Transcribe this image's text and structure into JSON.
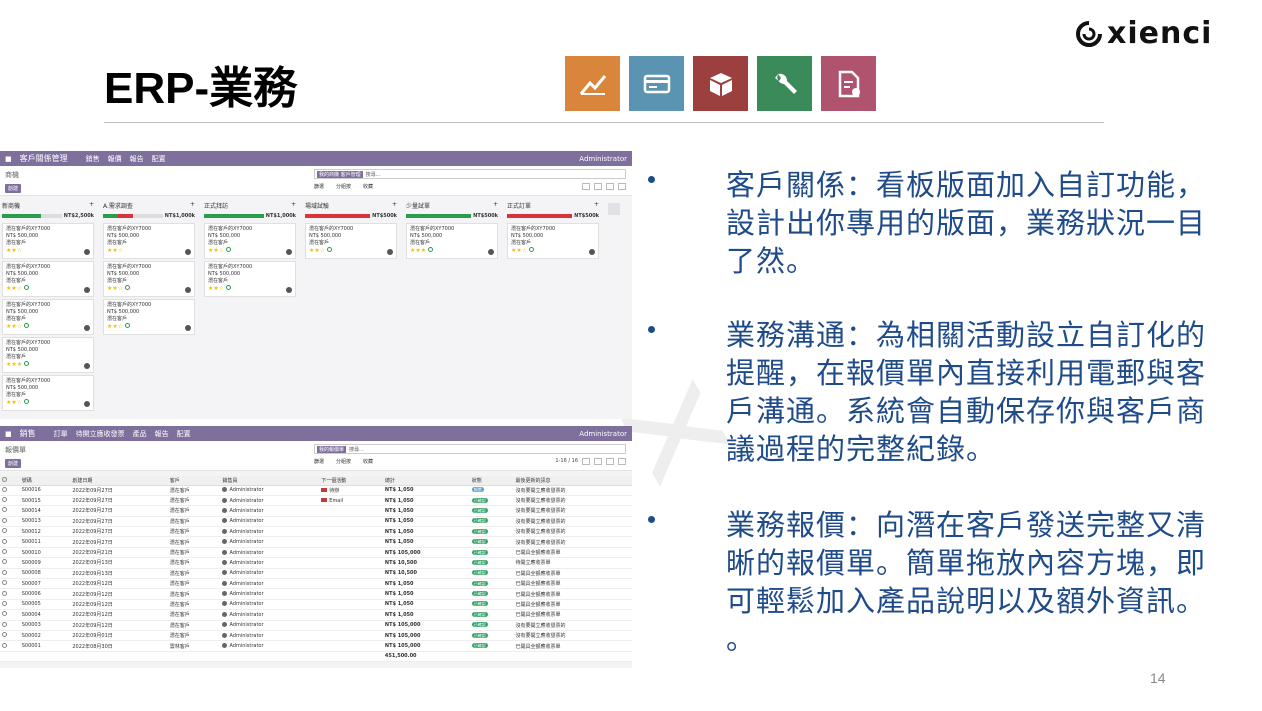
{
  "brand": {
    "logo_text": "xienci"
  },
  "slide": {
    "title": "ERP-業務",
    "page_number": "14"
  },
  "app_icons": [
    {
      "name": "chart-icon",
      "color": "#d9853b"
    },
    {
      "name": "card-icon",
      "color": "#5b94b3"
    },
    {
      "name": "box-icon",
      "color": "#9b3f3f"
    },
    {
      "name": "wrench-icon",
      "color": "#3a8a5a"
    },
    {
      "name": "doc-gear-icon",
      "color": "#b0536e"
    }
  ],
  "crm": {
    "app_name": "客戶關係管理",
    "menus": [
      "銷售",
      "報價",
      "報告",
      "配置"
    ],
    "user": "Administrator",
    "breadcrumb": "商機",
    "create_label": "創建",
    "search_facet": "我的商機 客戶管理",
    "search_placeholder": "搜尋...",
    "filters": [
      "篩選",
      "分組按",
      "收藏"
    ],
    "columns": [
      {
        "name": "新商機",
        "amount": "NT$2,500k"
      },
      {
        "name": "A.需求調查",
        "amount": "NT$1,000k"
      },
      {
        "name": "正式拜訪",
        "amount": "NT$1,000k"
      },
      {
        "name": "場域試驗",
        "amount": "NT$500k"
      },
      {
        "name": "少量試單",
        "amount": "NT$500k"
      },
      {
        "name": "正式訂單",
        "amount": "NT$500k"
      }
    ],
    "card_title": "潛在客戶的XY7000",
    "card_amount": "NT$ 500,000",
    "card_customer": "潛在客戶"
  },
  "sales": {
    "app_name": "銷售",
    "menus": [
      "訂單",
      "待開立應收發票",
      "產品",
      "報告",
      "配置"
    ],
    "user": "Administrator",
    "breadcrumb": "報價單",
    "create_label": "創建",
    "search_facet": "我的報價單",
    "search_placeholder": "搜尋...",
    "filters": [
      "篩選",
      "分組按",
      "收藏"
    ],
    "pager": "1-16 / 16",
    "headers": [
      "號碼",
      "創建日期",
      "客戶",
      "銷售員",
      "下一個活動",
      "",
      "總計",
      "狀態",
      "最後更新的訊息"
    ],
    "rows": [
      {
        "num": "S00016",
        "date": "2022年09月27日",
        "cust": "潛在客戶",
        "rep": "Administrator",
        "act": "待辦",
        "total": "NT$ 1,050",
        "status": "報價",
        "msg": "沒有要開立應收發票的"
      },
      {
        "num": "S00015",
        "date": "2022年09月27日",
        "cust": "潛在客戶",
        "rep": "Administrator",
        "act": "Email",
        "total": "NT$ 1,050",
        "status": "已確認",
        "msg": "沒有要開立應收發票的"
      },
      {
        "num": "S00014",
        "date": "2022年09月27日",
        "cust": "潛在客戶",
        "rep": "Administrator",
        "act": "",
        "total": "NT$ 1,050",
        "status": "已確認",
        "msg": "沒有要開立應收發票的"
      },
      {
        "num": "S00013",
        "date": "2022年09月27日",
        "cust": "潛在客戶",
        "rep": "Administrator",
        "act": "",
        "total": "NT$ 1,050",
        "status": "已確認",
        "msg": "沒有要開立應收發票的"
      },
      {
        "num": "S00012",
        "date": "2022年09月27日",
        "cust": "潛在客戶",
        "rep": "Administrator",
        "act": "",
        "total": "NT$ 1,050",
        "status": "已確認",
        "msg": "沒有要開立應收發票的"
      },
      {
        "num": "S00011",
        "date": "2022年09月27日",
        "cust": "潛在客戶",
        "rep": "Administrator",
        "act": "",
        "total": "NT$ 1,050",
        "status": "已確認",
        "msg": "沒有要開立應收發票的"
      },
      {
        "num": "S00010",
        "date": "2022年09月21日",
        "cust": "潛在客戶",
        "rep": "Administrator",
        "act": "",
        "total": "NT$ 105,000",
        "status": "已確認",
        "msg": "已開具全額應收票單"
      },
      {
        "num": "S00009",
        "date": "2022年09月13日",
        "cust": "潛在客戶",
        "rep": "Administrator",
        "act": "",
        "total": "NT$ 10,500",
        "status": "已確認",
        "msg": "待開立應收票單"
      },
      {
        "num": "S00008",
        "date": "2022年09月13日",
        "cust": "潛在客戶",
        "rep": "Administrator",
        "act": "",
        "total": "NT$ 10,500",
        "status": "已確認",
        "msg": "已開具全額應收票單"
      },
      {
        "num": "S00007",
        "date": "2022年09月12日",
        "cust": "潛在客戶",
        "rep": "Administrator",
        "act": "",
        "total": "NT$ 1,050",
        "status": "已確認",
        "msg": "已開具全額應收票單"
      },
      {
        "num": "S00006",
        "date": "2022年09月12日",
        "cust": "潛在客戶",
        "rep": "Administrator",
        "act": "",
        "total": "NT$ 1,050",
        "status": "已確認",
        "msg": "已開具全額應收票單"
      },
      {
        "num": "S00005",
        "date": "2022年09月12日",
        "cust": "潛在客戶",
        "rep": "Administrator",
        "act": "",
        "total": "NT$ 1,050",
        "status": "已確認",
        "msg": "已開具全額應收票單"
      },
      {
        "num": "S00004",
        "date": "2022年09月12日",
        "cust": "潛在客戶",
        "rep": "Administrator",
        "act": "",
        "total": "NT$ 1,050",
        "status": "已確認",
        "msg": "已開具全額應收票單"
      },
      {
        "num": "S00003",
        "date": "2022年09月12日",
        "cust": "潛在客戶",
        "rep": "Administrator",
        "act": "",
        "total": "NT$ 105,000",
        "status": "已確認",
        "msg": "沒有要開立應收發票的"
      },
      {
        "num": "S00002",
        "date": "2022年09月01日",
        "cust": "潛在客戶",
        "rep": "Administrator",
        "act": "",
        "total": "NT$ 105,000",
        "status": "已確認",
        "msg": "沒有要開立應收發票的"
      },
      {
        "num": "S00001",
        "date": "2022年08月30日",
        "cust": "雲林客戶",
        "rep": "Administrator",
        "act": "",
        "total": "NT$ 105,000",
        "status": "已確認",
        "msg": "已開具全額應收票單"
      }
    ],
    "grand_total": "451,500.00"
  },
  "bullets": [
    "客戶關係：看板版面加入自訂功能，設計出你專用的版面，業務狀況一目了然。",
    "業務溝通：為相關活動設立自訂化的提醒，在報價單內直接利用電郵與客戶溝通。系統會自動保存你與客戶商議過程的完整紀錄。",
    "業務報價：向潛在客戶發送完整又清晰的報價單。簡單拖放內容方塊，即可輕鬆加入產品說明以及額外資訊。 。"
  ]
}
